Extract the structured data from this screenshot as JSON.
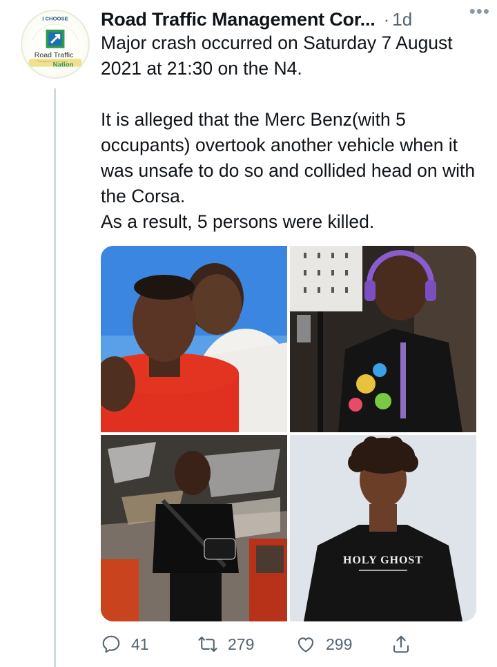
{
  "tweet": {
    "author": "Road Traffic Management Cor...",
    "separator": "·",
    "time": "1d",
    "more": "•••",
    "paragraphs": [
      "Major crash occurred on Saturday 7 August 2021 at 21:30 on the N4.",
      "It is alleged that the Merc Benz(with 5 occupants) overtook another vehicle when it was unsafe to do so and collided head on with the Corsa.",
      "As a result, 5 persons were killed."
    ]
  },
  "avatar": {
    "logo_text_top": "I CHOOSE",
    "logo_text_main": "Road Traffic",
    "logo_text_sub": "Management Corporation",
    "logo_text_badge": "Nation"
  },
  "photos": [
    {
      "label": "",
      "icon": "photo-two-men-selfie"
    },
    {
      "label": "",
      "icon": "photo-dj-headphones"
    },
    {
      "label": "",
      "icon": "photo-man-crossbody-bag"
    },
    {
      "label": "HOLY GHOST",
      "icon": "photo-young-man-tshirt"
    }
  ],
  "actions": {
    "reply_count": "41",
    "retweet_count": "279",
    "like_count": "299"
  },
  "colors": {
    "text": "#0f1419",
    "secondary": "#536471",
    "thread_line": "#cfd9de"
  }
}
